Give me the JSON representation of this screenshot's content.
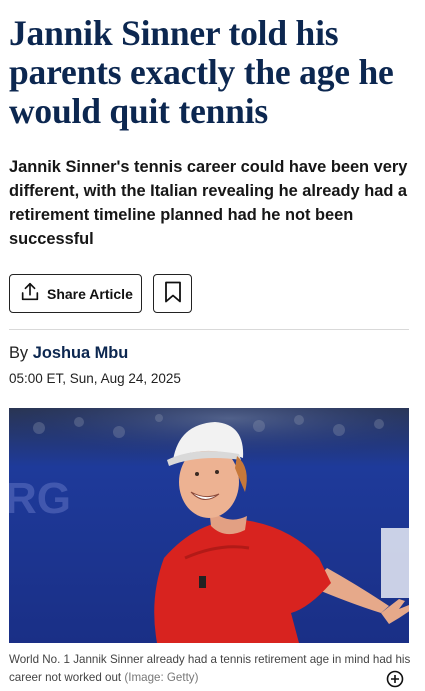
{
  "article": {
    "headline": "Jannik Sinner told his parents exactly the age he would quit tennis",
    "standfirst": "Jannik Sinner's tennis career could have been very different, with the Italian revealing he already had a retirement timeline planned had he not been successful",
    "share_label": "Share Article",
    "byline_prefix": "By",
    "author": "Joshua Mbu",
    "dateline": "05:00 ET, Sun, Aug 24, 2025",
    "image": {
      "caption": "World No. 1 Jannik Sinner already had a tennis retirement age in mind had his career not worked out",
      "credit": "(Image: Getty)"
    }
  },
  "icons": {
    "share": "share-icon",
    "bookmark": "bookmark-icon",
    "expand": "expand-plus-icon"
  },
  "colors": {
    "headline": "#0c2750",
    "author": "#0c2750"
  }
}
